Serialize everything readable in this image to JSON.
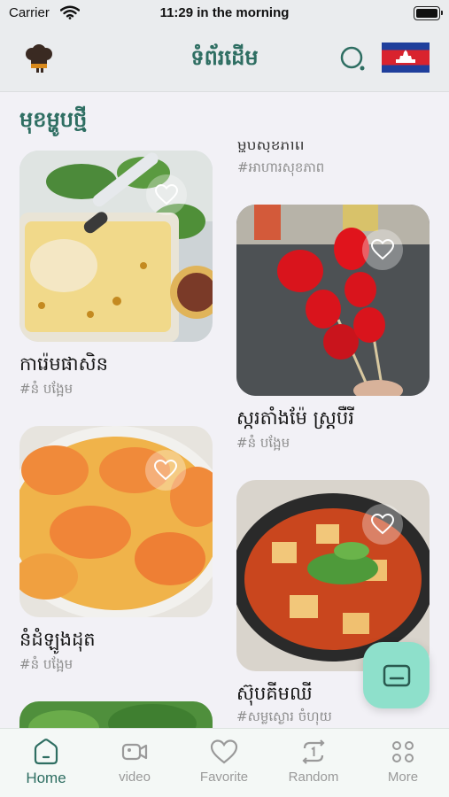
{
  "status_bar": {
    "carrier": "Carrier",
    "time": "11:29 in the morning"
  },
  "header": {
    "title": "ទំព័រដើម",
    "logo_icon": "chef-hat-icon",
    "search_icon": "search-icon",
    "flag_icon": "cambodia-flag-icon"
  },
  "section": {
    "title": "មុខម្ហូបថ្មី"
  },
  "top_peek": {
    "title": "ម្ហូបសុខភាព",
    "tag": "#អាហារសុខភាព"
  },
  "recipes": [
    {
      "title": "ការ៉េមផាសិន",
      "tag": "#នំ បង្អែម"
    },
    {
      "title": "ស្ករតាំងម៉ែ ស្ត្របឺរី",
      "tag": "#នំ បង្អែម"
    },
    {
      "title": "នំដំឡូងដុត",
      "tag": "#នំ បង្អែម"
    },
    {
      "title": "ស៊ុបគីមឈី",
      "tag": "#សម្ល​ស្ងោរ ចំហុយ"
    }
  ],
  "tabs": [
    {
      "label": "Home",
      "icon": "home-icon",
      "active": true
    },
    {
      "label": "video",
      "icon": "video-icon",
      "active": false
    },
    {
      "label": "Favorite",
      "icon": "heart-icon",
      "active": false
    },
    {
      "label": "Random",
      "icon": "random-icon",
      "active": false
    },
    {
      "label": "More",
      "icon": "more-grid-icon",
      "active": false
    }
  ],
  "colors": {
    "accent": "#2e6e62",
    "fab": "#8ee0cb",
    "background": "#f2f1f6"
  }
}
